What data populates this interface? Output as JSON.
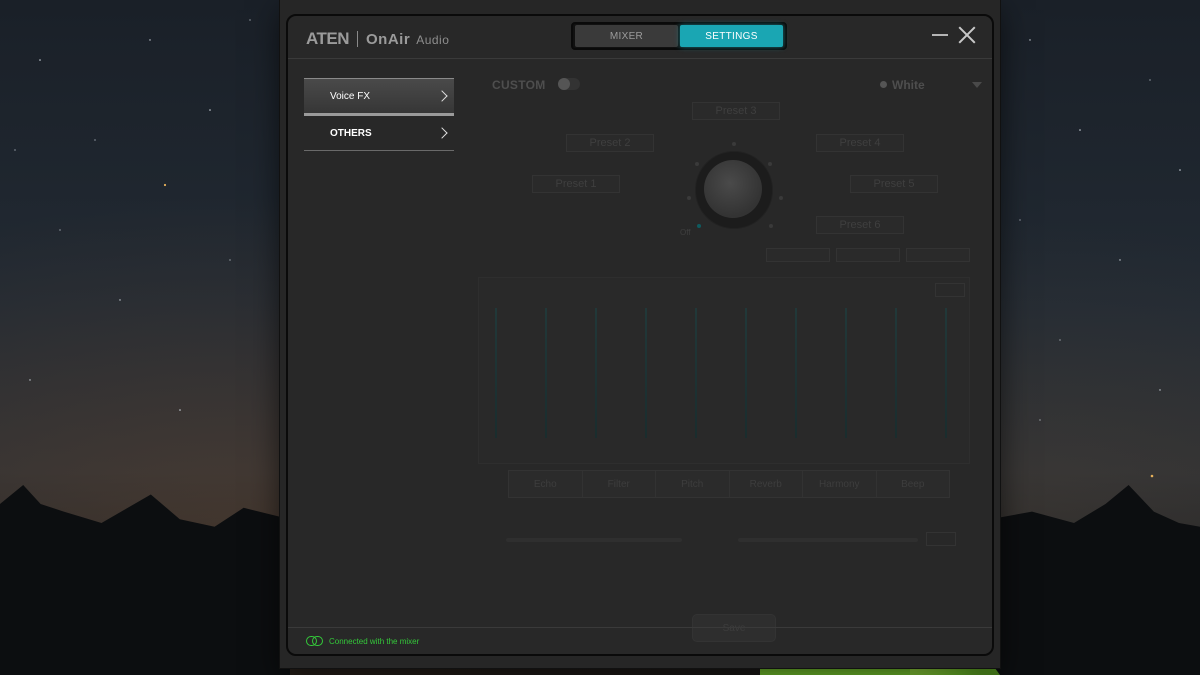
{
  "header": {
    "logo_brand": "ATEN",
    "logo_product": "OnAir",
    "logo_sub": "Audio",
    "tabs": [
      {
        "label": "MIXER",
        "active": false
      },
      {
        "label": "SETTINGS",
        "active": true
      }
    ]
  },
  "sidebar": {
    "items": [
      {
        "label": "Voice FX",
        "active": true
      },
      {
        "label": "OTHERS",
        "active": false
      }
    ]
  },
  "voicefx": {
    "custom_label": "CUSTOM",
    "custom_enabled": false,
    "theme_label": "White",
    "knob_off_label": "Off",
    "presets": [
      "Preset 1",
      "Preset 2",
      "Preset 3",
      "Preset 4",
      "Preset 5",
      "Preset 6"
    ],
    "fx_tabs": [
      "Echo",
      "Filter",
      "Pitch",
      "Reverb",
      "Harmony",
      "Beep"
    ],
    "save_label": "Save"
  },
  "status": {
    "text": "Connected with the mixer",
    "color": "#34c93a"
  },
  "colors": {
    "accent": "#1aa6b3",
    "status_ok": "#34c93a"
  }
}
